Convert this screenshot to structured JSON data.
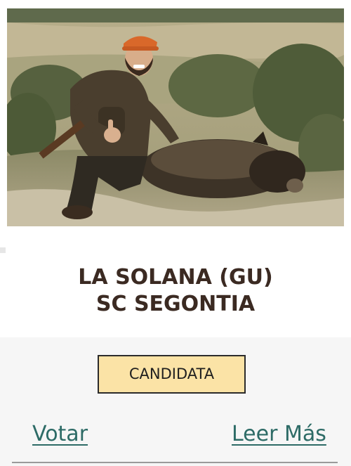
{
  "card": {
    "photo": {
      "icon": "hunter-with-boar-photo"
    },
    "title_line1": "LA SOLANA (GU)",
    "title_line2": "SC SEGONTIA",
    "badge_label": "CANDIDATA",
    "vote_label": "Votar",
    "read_more_label": "Leer Más"
  },
  "colors": {
    "title": "#3b2a22",
    "badge_background": "#fbe3a6",
    "badge_border": "#2b2b2b",
    "link": "#2d6b66",
    "card_bottom_background": "#f6f6f6"
  }
}
